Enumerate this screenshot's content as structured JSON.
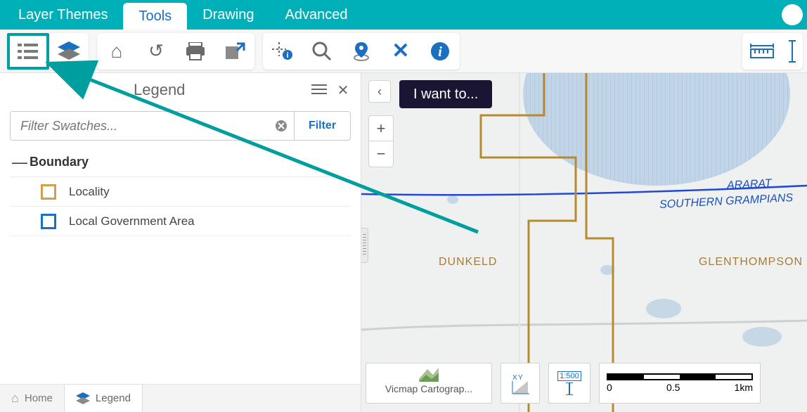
{
  "tabs": {
    "layer_themes": "Layer Themes",
    "tools": "Tools",
    "drawing": "Drawing",
    "advanced": "Advanced",
    "active": "Tools"
  },
  "toolbar": {
    "legend_btn": "legend",
    "layers_btn": "layers",
    "home_btn": "home",
    "refresh_btn": "refresh",
    "print_btn": "print",
    "export_btn": "export",
    "identify_btn": "identify",
    "search_btn": "search",
    "locate_btn": "locate",
    "clear_btn": "clear",
    "info_btn": "info",
    "measure_btn": "measure",
    "ruler_v_btn": "ruler-vertical"
  },
  "panel": {
    "title": "Legend",
    "filter_placeholder": "Filter Swatches...",
    "filter_button": "Filter",
    "groups": [
      {
        "name": "Boundary",
        "collapse": "—",
        "items": [
          {
            "label": "Locality",
            "color": "#d1a04a"
          },
          {
            "label": "Local Government Area",
            "color": "#1a6fc0"
          }
        ]
      }
    ]
  },
  "panel_tabs": {
    "home": "Home",
    "legend": "Legend",
    "active": "Legend"
  },
  "map": {
    "i_want_to": "I want to...",
    "back": "‹",
    "zoom_in": "+",
    "zoom_out": "−",
    "places": {
      "dunkeld": "DUNKELD",
      "glenthompson": "GLENTHOMPSON"
    },
    "boundary_labels": {
      "top": "ARARAT",
      "bottom": "SOUTHERN GRAMPIANS"
    },
    "basemap_card": "Vicmap Cartograp...",
    "xy_card": "XY",
    "scale_card": "1:500",
    "scalebar": {
      "t0": "0",
      "t1": "0.5",
      "t2": "1km"
    }
  }
}
